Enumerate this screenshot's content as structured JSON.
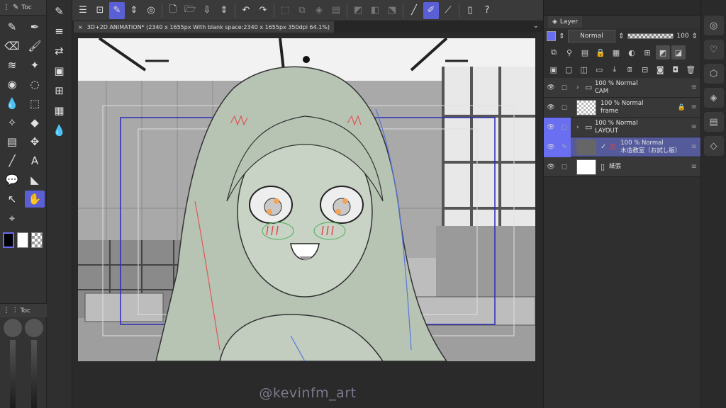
{
  "tool_panel": {
    "header_label": "Toc",
    "lower_header_label": "Toc",
    "tools": [
      {
        "icon": "pen-icon",
        "glyph": "✎"
      },
      {
        "icon": "marker-icon",
        "glyph": "✒"
      },
      {
        "icon": "eraser-icon",
        "glyph": "⌫"
      },
      {
        "icon": "brush-icon",
        "glyph": "🖌"
      },
      {
        "icon": "airbrush-icon",
        "glyph": "≋"
      },
      {
        "icon": "sparkle-icon",
        "glyph": "✦"
      },
      {
        "icon": "fill-icon",
        "glyph": "◉"
      },
      {
        "icon": "lasso-icon",
        "glyph": "◌"
      },
      {
        "icon": "blend-icon",
        "glyph": "💧"
      },
      {
        "icon": "select-icon",
        "glyph": "⬚"
      },
      {
        "icon": "magic-wand-icon",
        "glyph": "✧"
      },
      {
        "icon": "bucket-icon",
        "glyph": "◆"
      },
      {
        "icon": "gradient-icon",
        "glyph": "▤"
      },
      {
        "icon": "move-icon",
        "glyph": "✥"
      },
      {
        "icon": "line-icon",
        "glyph": "╱"
      },
      {
        "icon": "text-icon",
        "glyph": "A"
      },
      {
        "icon": "balloon-icon",
        "glyph": "💬"
      },
      {
        "icon": "frame-icon",
        "glyph": "◣"
      },
      {
        "icon": "operation-icon",
        "glyph": "↖"
      },
      {
        "icon": "hand-icon",
        "glyph": "✋",
        "active": true
      },
      {
        "icon": "eyedropper-icon",
        "glyph": "⌖"
      }
    ]
  },
  "sub_tools": [
    {
      "icon": "sub-tool-1-icon",
      "glyph": "✎"
    },
    {
      "icon": "sub-tool-2-icon",
      "glyph": "≡"
    },
    {
      "icon": "sub-tool-3-icon",
      "glyph": "⇄"
    },
    {
      "icon": "sub-tool-4-icon",
      "glyph": "▣"
    },
    {
      "icon": "sub-tool-5-icon",
      "glyph": "⊞"
    },
    {
      "icon": "sub-tool-6-icon",
      "glyph": "▦"
    },
    {
      "icon": "sub-tool-7-icon",
      "glyph": "💧"
    }
  ],
  "command_bar": [
    {
      "icon": "menu-icon",
      "glyph": "☰"
    },
    {
      "icon": "fit-icon",
      "glyph": "⊡"
    },
    {
      "icon": "edit-icon",
      "glyph": "✎",
      "active": true
    },
    {
      "icon": "stepper-icon",
      "glyph": "⇕"
    },
    {
      "icon": "mode-icon",
      "glyph": "◎"
    },
    {
      "sep": true
    },
    {
      "icon": "new-icon",
      "glyph": "🗋"
    },
    {
      "icon": "open-icon",
      "glyph": "🗁"
    },
    {
      "icon": "save-icon",
      "glyph": "⇩"
    },
    {
      "icon": "stepper2-icon",
      "glyph": "⇕"
    },
    {
      "sep": true
    },
    {
      "icon": "undo-icon",
      "glyph": "↶"
    },
    {
      "icon": "redo-icon",
      "glyph": "↷"
    },
    {
      "sep": true
    },
    {
      "icon": "deselect-icon",
      "glyph": "⬚",
      "dim": true
    },
    {
      "icon": "copy-icon",
      "glyph": "⧉",
      "dim": true
    },
    {
      "icon": "clip-icon",
      "glyph": "◈",
      "dim": true
    },
    {
      "icon": "paste-icon",
      "glyph": "▤",
      "dim": true
    },
    {
      "sep": true
    },
    {
      "icon": "clear-icon",
      "glyph": "◩",
      "dim": true
    },
    {
      "icon": "fill-sel-icon",
      "glyph": "◧",
      "dim": true
    },
    {
      "icon": "transform-icon",
      "glyph": "⬔",
      "dim": true
    },
    {
      "sep": true
    },
    {
      "icon": "ruler-icon",
      "glyph": "╱"
    },
    {
      "icon": "brush-cmd-icon",
      "glyph": "✐",
      "active": true
    },
    {
      "icon": "vector-icon",
      "glyph": "⟋"
    },
    {
      "sep": true
    },
    {
      "icon": "device-icon",
      "glyph": "▯"
    },
    {
      "icon": "help-icon",
      "glyph": "?"
    }
  ],
  "document_tab": {
    "close_glyph": "×",
    "title": "3D+2D ANIMATION* (2340 x 1655px With blank space:2340 x 1655px 350dpi 64.1%)"
  },
  "watermark": "@kevinfm_art",
  "layer_panel": {
    "tab_label": "Layer",
    "blend_mode": "Normal",
    "opacity": "100",
    "layers": [
      {
        "type": "folder",
        "line1": "100 %  Normal",
        "line2": "CAM",
        "selected": false,
        "hl": false,
        "thumb": "none"
      },
      {
        "type": "layer",
        "line1": "100 %  Normal",
        "line2": "frame",
        "selected": false,
        "hl": false,
        "thumb": "checker",
        "locked": true
      },
      {
        "type": "folder",
        "line1": "100 %  Normal",
        "line2": "LAYOUT",
        "selected": false,
        "hl": true,
        "thumb": "none"
      },
      {
        "type": "3d",
        "line1": "100 %  Normal",
        "line2": "木造教室（お試し版）",
        "selected": true,
        "hl": true,
        "thumb": "dark"
      },
      {
        "type": "paper",
        "line1": "",
        "line2": "紙張",
        "selected": false,
        "hl": false,
        "thumb": "white"
      }
    ]
  },
  "right_strip": [
    {
      "icon": "navigator-icon",
      "glyph": "◎"
    },
    {
      "icon": "sub-view-icon",
      "glyph": "♡"
    },
    {
      "icon": "material-icon",
      "glyph": "⬡"
    },
    {
      "icon": "layer-strip-icon",
      "glyph": "◈"
    },
    {
      "icon": "timeline-icon",
      "glyph": "▤"
    },
    {
      "icon": "property-icon",
      "glyph": "◇"
    }
  ]
}
